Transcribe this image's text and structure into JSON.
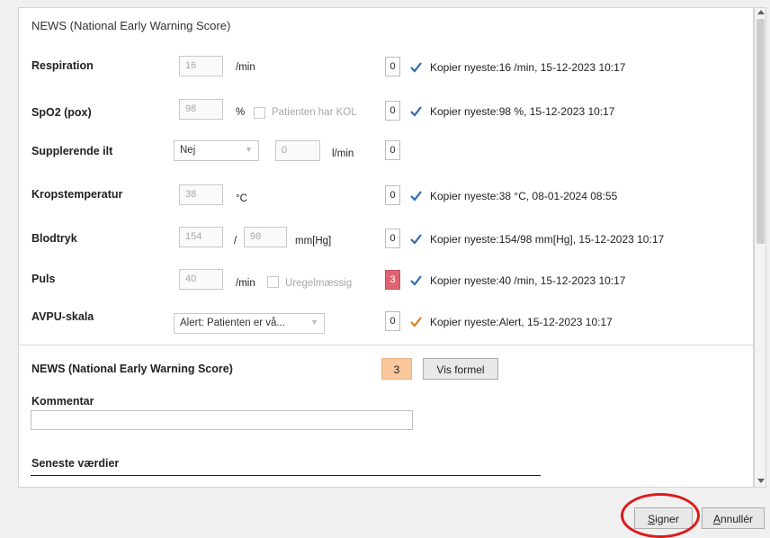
{
  "section_title": "NEWS (National Early Warning Score)",
  "rows": {
    "respiration": {
      "label": "Respiration",
      "value": "16",
      "unit": "/min",
      "score": "0",
      "copy_checked": true,
      "copy_text": "Kopier nyeste:16 /min, 15-12-2023 10:17"
    },
    "spo2": {
      "label": "SpO2 (pox)",
      "value": "98",
      "unit": "%",
      "kol_label": "Patienten har KOL",
      "kol_checked": false,
      "score": "0",
      "copy_checked": true,
      "copy_text": "Kopier nyeste:98 %, 15-12-2023 10:17"
    },
    "oxygen": {
      "label": "Supplerende ilt",
      "selected": "Nej",
      "value": "0",
      "unit": "l/min",
      "score": "0"
    },
    "temperature": {
      "label": "Kropstemperatur",
      "value": "38",
      "unit": "°C",
      "score": "0",
      "copy_checked": true,
      "copy_text": "Kopier nyeste:38 °C, 08-01-2024 08:55"
    },
    "bloodpressure": {
      "label": "Blodtryk",
      "systolic": "154",
      "separator": "/",
      "diastolic": "98",
      "unit": "mm[Hg]",
      "score": "0",
      "copy_checked": true,
      "copy_text": "Kopier nyeste:154/98 mm[Hg], 15-12-2023 10:17"
    },
    "pulse": {
      "label": "Puls",
      "value": "40",
      "unit": "/min",
      "irregular_label": "Uregelmæssig",
      "irregular_checked": false,
      "score": "3",
      "copy_checked": true,
      "copy_text": "Kopier nyeste:40 /min, 15-12-2023 10:17"
    },
    "avpu": {
      "label": "AVPU-skala",
      "selected": "Alert: Patienten er vå...",
      "score": "0",
      "copy_checked": true,
      "copy_text": "Kopier nyeste:Alert, 15-12-2023 10:17"
    }
  },
  "news_total": {
    "label": "NEWS (National Early Warning Score)",
    "score": "3",
    "formula_button": "Vis formel"
  },
  "comment": {
    "label": "Kommentar",
    "value": ""
  },
  "latest_values": {
    "label": "Seneste værdier"
  },
  "footer": {
    "sign_accel": "S",
    "sign_rest": "igner",
    "cancel_accel": "A",
    "cancel_rest": "nnullér"
  },
  "colors": {
    "score_red": "#e06470",
    "news_orange": "#f8c79b",
    "check_blue": "#2b6cb0",
    "check_orange": "#e07b1a",
    "highlight_red": "#dd1b1b"
  }
}
